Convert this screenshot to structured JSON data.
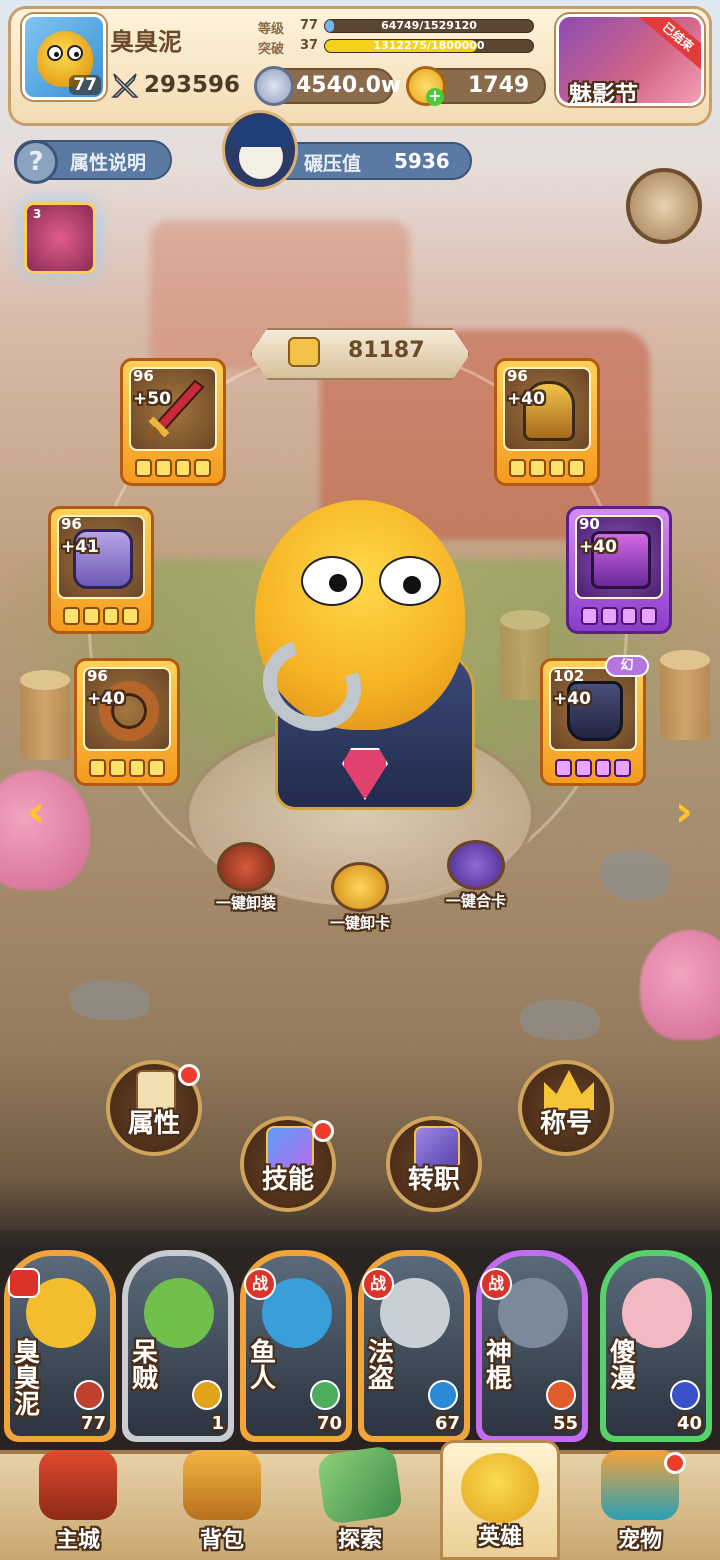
{
  "player": {
    "name": "臭臭泥",
    "level": "77",
    "power": "293596",
    "grade_label": "等级",
    "grade_value": "77",
    "grade_exp": "64749/1529120",
    "grade_progress": 0.042,
    "break_label": "突破",
    "break_value": "37",
    "break_exp": "1312275/1800000",
    "break_progress": 0.729
  },
  "currency": {
    "silver": "4540.0w",
    "gold": "1749"
  },
  "event": {
    "title": "魅影节",
    "badge": "已结束"
  },
  "info": {
    "attr_help": "属性说明",
    "crush_label": "碾压值",
    "crush_value": "5936"
  },
  "buff": {
    "count": "3"
  },
  "equipment": {
    "score": "81187",
    "slots": [
      {
        "name": "weapon",
        "level": "96",
        "plus": "+50",
        "tier": "gold",
        "stars": 4
      },
      {
        "name": "helmet",
        "level": "96",
        "plus": "+40",
        "tier": "gold",
        "stars": 4
      },
      {
        "name": "armor",
        "level": "96",
        "plus": "+41",
        "tier": "gold",
        "stars": 4
      },
      {
        "name": "legs",
        "level": "90",
        "plus": "+40",
        "tier": "purple",
        "stars": 4
      },
      {
        "name": "ring",
        "level": "96",
        "plus": "+40",
        "tier": "gold",
        "stars": 4
      },
      {
        "name": "boots",
        "level": "102",
        "plus": "+40",
        "tier": "purple",
        "stars": 4,
        "badge": "幻"
      }
    ]
  },
  "quick_actions": {
    "unequip": "一键卸装",
    "uncard": "一键卸卡",
    "merge": "一键合卡"
  },
  "menu": {
    "attributes": "属性",
    "skills": "技能",
    "class_change": "转职",
    "titles": "称号"
  },
  "heroes": [
    {
      "name": "臭臭泥",
      "level": "77",
      "color": "#f0a43a",
      "crown": true,
      "badge": ""
    },
    {
      "name": "呆贼",
      "level": "1",
      "color": "#c9cdd2",
      "badge": ""
    },
    {
      "name": "鱼人",
      "level": "70",
      "color": "#f0a43a",
      "badge": "战"
    },
    {
      "name": "法盗",
      "level": "67",
      "color": "#f0a43a",
      "badge": "战"
    },
    {
      "name": "神棍",
      "level": "55",
      "color": "#c46cf0",
      "badge": "战"
    },
    {
      "name": "傻漫",
      "level": "40",
      "color": "#57d26a",
      "badge": ""
    }
  ],
  "nav": {
    "main_city": "主城",
    "backpack": "背包",
    "explore": "探索",
    "hero": "英雄",
    "pet": "宠物"
  },
  "icons": {
    "sword": "sword-icon",
    "silver": "silver-coin-icon",
    "gold": "gold-coin-icon",
    "help": "question-icon",
    "arrow_left": "chevron-left-icon",
    "arrow_right": "chevron-right-icon"
  }
}
